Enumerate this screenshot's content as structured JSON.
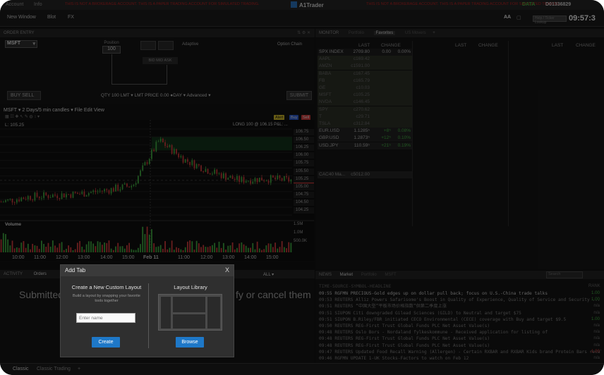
{
  "titlebar": {
    "menu": [
      "Account",
      "Info"
    ],
    "warning": "THIS IS NOT A BROKERAGE ACCOUNT. THIS IS A PAPER TRADING ACCOUNT FOR SIMULATED TRADING.",
    "app_title": "A1Trader",
    "data_label": "DATA",
    "account_id": "D01336829"
  },
  "toolbar": {
    "items": [
      "New Window",
      "Blot",
      "FX"
    ],
    "font_size_label": "AA",
    "search_placeholder": "Help / Ticker Lookup",
    "clock": "09:57:3"
  },
  "order_entry": {
    "panel_title": "ORDER ENTRY",
    "symbol": "MSFT",
    "position_label": "Position",
    "position_value": "100",
    "algo": "Adaptive",
    "option_chain": "Option Chain",
    "bid_ask": "BID MID ASK",
    "buy_sell": "BUY  SELL",
    "order_line": "QTY 100  LMT ▾  LMT PRICE 0.00  ●DAY ▾  Advanced ▾",
    "submit": "SUBMIT"
  },
  "chart": {
    "toolbar": "MSFT ▾  2 Days/5 min candles ▾  File  Edit  View",
    "legend_left": "L: 105.25",
    "legend_right": "LONG 100 @ 106.15 P&L: ...",
    "badges": [
      "Alert",
      "Buy",
      "Sell"
    ],
    "volume_label": "Volume",
    "x_labels": [
      "10:00",
      "11:00",
      "12:00",
      "13:00",
      "14:00",
      "15:00",
      "Feb 11",
      "11:00",
      "12:00",
      "13:00",
      "14:00",
      "15:00"
    ],
    "volume_ticks": [
      "1.5M",
      "1.0M",
      "500.0K"
    ],
    "price_ticks": [
      "106.75",
      "106.50",
      "106.25",
      "106.00",
      "105.75",
      "105.50",
      "105.25",
      "105.00",
      "104.75",
      "104.50",
      "104.25"
    ],
    "current_price": "105.25"
  },
  "chart_data": {
    "type": "line",
    "title": "MSFT 2 Days/5 min candles",
    "xlabel": "",
    "ylabel": "",
    "ylim": [
      104.1,
      106.9
    ],
    "grid": true,
    "x": [
      "10:00",
      "11:00",
      "12:00",
      "13:00",
      "14:00",
      "15:00",
      "Feb 11",
      "11:00",
      "12:00",
      "13:00",
      "14:00",
      "15:00"
    ],
    "series": [
      {
        "name": "MSFT",
        "values": [
          104.6,
          104.75,
          104.8,
          104.85,
          104.95,
          105.1,
          106.45,
          105.85,
          105.5,
          105.25,
          105.3,
          105.25
        ]
      }
    ]
  },
  "monitor": {
    "tabs": [
      "MONITOR",
      "Portfolio",
      "Favorites",
      "US Movers",
      "+"
    ],
    "col_headers": [
      "LAST",
      "CHANGE",
      "LAST",
      "CHANGE",
      "LAST",
      "CHANGE"
    ],
    "rows": [
      {
        "symbol": "SPX INDEX",
        "last": "2709.80",
        "change": "0.00",
        "pct": "0.00%"
      },
      {
        "symbol": "AAPL",
        "last": "c169.42",
        "change": "",
        "pct": ""
      },
      {
        "symbol": "AMZN",
        "last": "c1591.00",
        "change": "",
        "pct": ""
      },
      {
        "symbol": "BABA",
        "last": "c167.45",
        "change": "",
        "pct": ""
      },
      {
        "symbol": "FB",
        "last": "c165.79",
        "change": "",
        "pct": ""
      },
      {
        "symbol": "GE",
        "last": "c10.03",
        "change": "",
        "pct": ""
      },
      {
        "symbol": "MSFT",
        "last": "c105.25",
        "change": "",
        "pct": ""
      },
      {
        "symbol": "NVDA",
        "last": "c146.45",
        "change": "",
        "pct": ""
      },
      {
        "symbol": "SPY",
        "last": "c270.62",
        "change": "",
        "pct": ""
      },
      {
        "symbol": "T",
        "last": "c29.71",
        "change": "",
        "pct": ""
      },
      {
        "symbol": "TSLA",
        "last": "c312.84",
        "change": "",
        "pct": ""
      },
      {
        "symbol": "EUR.USD",
        "last": "1.1285⁵",
        "change": "+8⁵",
        "pct": "0.08%"
      },
      {
        "symbol": "GBP.USD",
        "last": "1.2873⁵",
        "change": "+12⁵",
        "pct": "0.10%"
      },
      {
        "symbol": "USD.JPY",
        "last": "110.59⁵",
        "change": "+21⁵",
        "pct": "0.19%"
      }
    ],
    "extra_row": {
      "symbol": "CAC40 Ma...",
      "last": "c5012.00"
    }
  },
  "news": {
    "tabs": [
      "NEWS",
      "Market",
      "Portfolio",
      "MSFT"
    ],
    "search_placeholder": "Search",
    "headers": {
      "main": "TIME-SOURCE-SYMBOL-HEADLINE",
      "rank": "RANK"
    },
    "items": [
      {
        "text": "09:55 RGFMN PRECIOUS-Gold edges up on dollar pull back; focus on U.S.-China trade talks",
        "rank": "1.00"
      },
      {
        "text": "09:53 REUTERS Alliz Powers Safarisome's Boost in Quality of Experience, Quality of Service and Security ...",
        "rank": "1.00"
      },
      {
        "text": "09:51 REUTERS “中国大型”平板市场价格指数”供第二季度上涨",
        "rank": "n/a"
      },
      {
        "text": "09:51 SIUPON Citi downgraded Gilead Sciences (GILD) to Neutral and target $75",
        "rank": "n/a"
      },
      {
        "text": "09:51 SIUPON B.Riley/FBR initiated CECO Environmental (CECE) coverage with Buy and target $9.5",
        "rank": "1.00"
      },
      {
        "text": "09:50 REUTERS REG-First Trust Global Funds PLC Net Asset Value(s)",
        "rank": "n/a"
      },
      {
        "text": "09:48 REUTERS Oslo Bors - Nordaland fylkeskommune - Received application for listing of",
        "rank": "n/a"
      },
      {
        "text": "09:48 REUTERS REG-First Trust Global Funds PLC Net Asset Value(s)",
        "rank": "n/a"
      },
      {
        "text": "09:48 REUTERS REG-First Trust Global Funds PLC Net Asset Value(s)",
        "rank": "n/a"
      },
      {
        "text": "09:47 REUTERS Updated Food Recall Warning (Allergen) - Certain RXBAR and RXBAR Kids brand Protein Bars recalle...",
        "rank": "-1.00"
      },
      {
        "text": "09:46 RGFMN UPDATE 1-UK Stocks-Factors to watch on Feb 12",
        "rank": "n/a"
      }
    ]
  },
  "activity": {
    "tabs": [
      "ACTIVITY",
      "Orders"
    ],
    "submitted_text": "Submitted",
    "cancel_text": "fy or cancel them",
    "all_label": "ALL ▾"
  },
  "bottom_tabs": [
    "Classic",
    "Classic Trading",
    "+"
  ],
  "dialog": {
    "title": "Add Tab",
    "close": "X",
    "left_heading": "Create a New Custom Layout",
    "left_desc": "Build a layout by snapping your favorite tools together",
    "input_placeholder": "Enter name",
    "create_label": "Create",
    "right_heading": "Layout Library",
    "browse_label": "Browse"
  },
  "colors": {
    "up": "#3fa33f",
    "down": "#c83a3a",
    "accent": "#1e78c8",
    "warning": "#b02020"
  }
}
